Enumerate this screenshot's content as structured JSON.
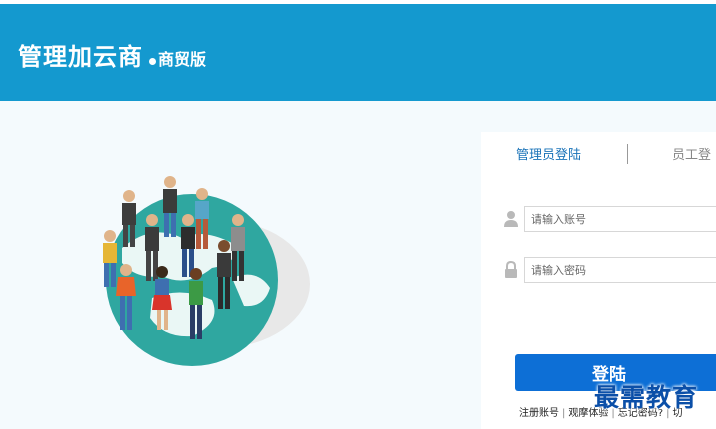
{
  "header": {
    "brand_name": "管理加云商",
    "brand_edition": "商贸版"
  },
  "login": {
    "tabs": [
      {
        "label": "管理员登陆"
      },
      {
        "label": "员工登"
      }
    ],
    "username": {
      "placeholder": "请输入账号",
      "value": ""
    },
    "password": {
      "placeholder": "请输入密码",
      "value": ""
    },
    "submit_label": "登陆",
    "links": [
      "注册账号",
      "观摩体验",
      "忘记密码?",
      "切"
    ]
  },
  "watermark": "最需教育",
  "colors": {
    "header_bg": "#1499cf",
    "button_bg": "#0d6fd6",
    "page_bg": "#f4fafd"
  },
  "icons": {
    "username": "user-icon",
    "password": "lock-icon"
  }
}
